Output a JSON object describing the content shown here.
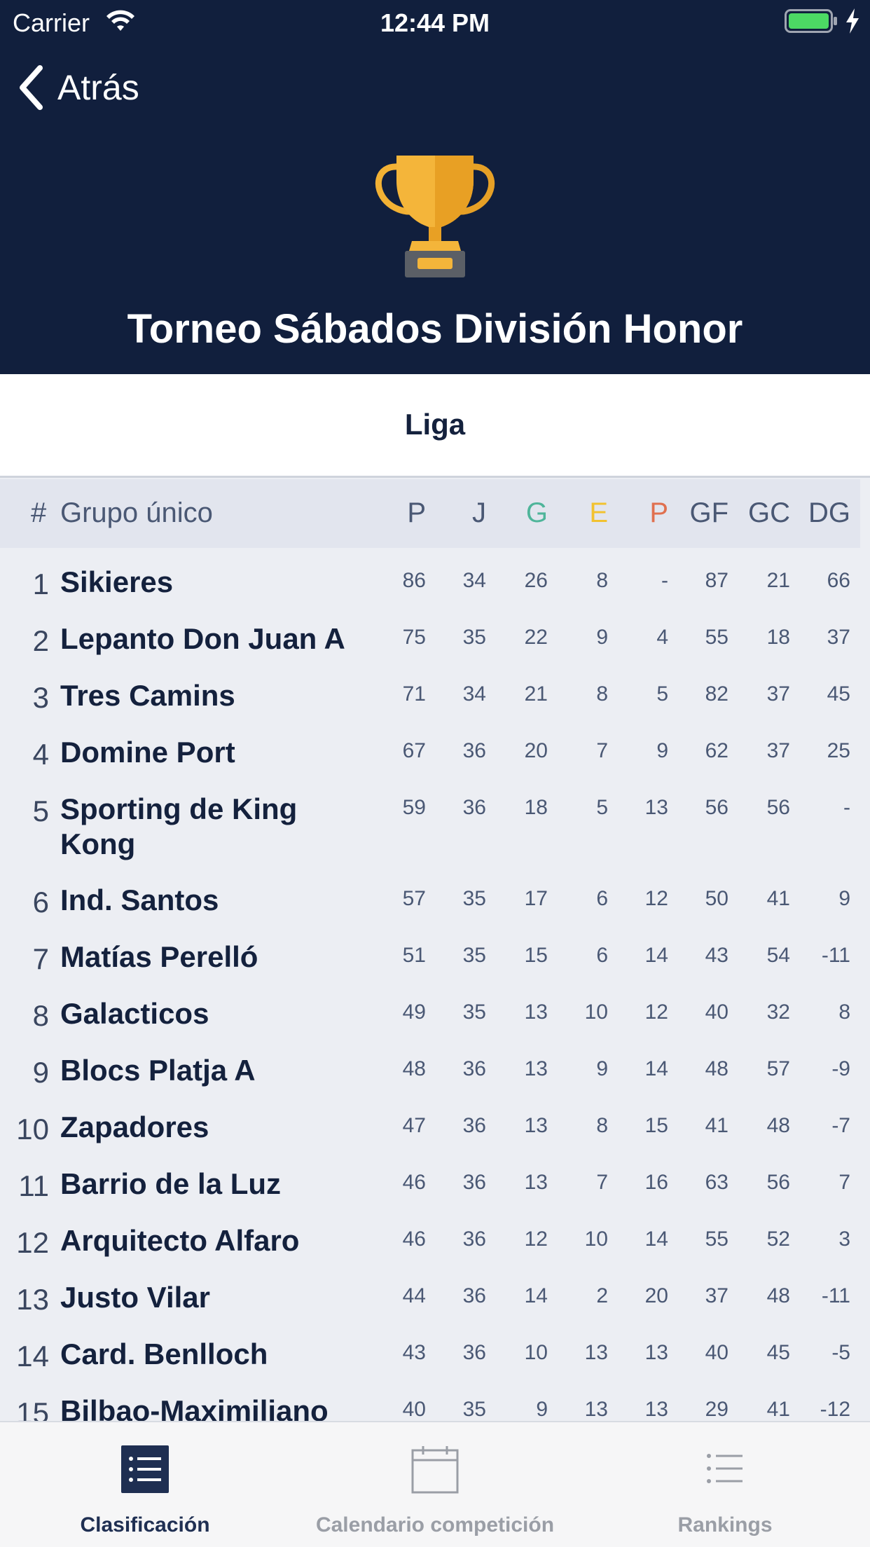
{
  "status_bar": {
    "carrier": "Carrier",
    "time": "12:44 PM"
  },
  "nav": {
    "back_label": "Atrás"
  },
  "header": {
    "title": "Torneo Sábados División Honor"
  },
  "segment": {
    "label": "Liga"
  },
  "table": {
    "headers": {
      "hash": "#",
      "group": "Grupo único",
      "pts": "P",
      "j": "J",
      "g": "G",
      "e": "E",
      "p": "P",
      "gf": "GF",
      "gc": "GC",
      "dg": "DG"
    },
    "header_colors": {
      "g": "#4fb59a",
      "e": "#f2c230",
      "p": "#e0704f"
    },
    "rows": [
      {
        "pos": "1",
        "team": "Sikieres",
        "pts": "86",
        "j": "34",
        "g": "26",
        "e": "8",
        "p": "-",
        "gf": "87",
        "gc": "21",
        "dg": "66"
      },
      {
        "pos": "2",
        "team": "Lepanto Don Juan A",
        "pts": "75",
        "j": "35",
        "g": "22",
        "e": "9",
        "p": "4",
        "gf": "55",
        "gc": "18",
        "dg": "37"
      },
      {
        "pos": "3",
        "team": "Tres Camins",
        "pts": "71",
        "j": "34",
        "g": "21",
        "e": "8",
        "p": "5",
        "gf": "82",
        "gc": "37",
        "dg": "45"
      },
      {
        "pos": "4",
        "team": "Domine Port",
        "pts": "67",
        "j": "36",
        "g": "20",
        "e": "7",
        "p": "9",
        "gf": "62",
        "gc": "37",
        "dg": "25"
      },
      {
        "pos": "5",
        "team": "Sporting de King Kong",
        "pts": "59",
        "j": "36",
        "g": "18",
        "e": "5",
        "p": "13",
        "gf": "56",
        "gc": "56",
        "dg": "-"
      },
      {
        "pos": "6",
        "team": "Ind. Santos",
        "pts": "57",
        "j": "35",
        "g": "17",
        "e": "6",
        "p": "12",
        "gf": "50",
        "gc": "41",
        "dg": "9"
      },
      {
        "pos": "7",
        "team": "Matías Perelló",
        "pts": "51",
        "j": "35",
        "g": "15",
        "e": "6",
        "p": "14",
        "gf": "43",
        "gc": "54",
        "dg": "-11"
      },
      {
        "pos": "8",
        "team": "Galacticos",
        "pts": "49",
        "j": "35",
        "g": "13",
        "e": "10",
        "p": "12",
        "gf": "40",
        "gc": "32",
        "dg": "8"
      },
      {
        "pos": "9",
        "team": "Blocs Platja A",
        "pts": "48",
        "j": "36",
        "g": "13",
        "e": "9",
        "p": "14",
        "gf": "48",
        "gc": "57",
        "dg": "-9"
      },
      {
        "pos": "10",
        "team": "Zapadores",
        "pts": "47",
        "j": "36",
        "g": "13",
        "e": "8",
        "p": "15",
        "gf": "41",
        "gc": "48",
        "dg": "-7"
      },
      {
        "pos": "11",
        "team": "Barrio de la Luz",
        "pts": "46",
        "j": "36",
        "g": "13",
        "e": "7",
        "p": "16",
        "gf": "63",
        "gc": "56",
        "dg": "7"
      },
      {
        "pos": "12",
        "team": "Arquitecto Alfaro",
        "pts": "46",
        "j": "36",
        "g": "12",
        "e": "10",
        "p": "14",
        "gf": "55",
        "gc": "52",
        "dg": "3"
      },
      {
        "pos": "13",
        "team": "Justo Vilar",
        "pts": "44",
        "j": "36",
        "g": "14",
        "e": "2",
        "p": "20",
        "gf": "37",
        "gc": "48",
        "dg": "-11"
      },
      {
        "pos": "14",
        "team": "Card. Benlloch",
        "pts": "43",
        "j": "36",
        "g": "10",
        "e": "13",
        "p": "13",
        "gf": "40",
        "gc": "45",
        "dg": "-5"
      },
      {
        "pos": "15",
        "team": "Bilbao-Maximiliano",
        "pts": "40",
        "j": "35",
        "g": "9",
        "e": "13",
        "p": "13",
        "gf": "29",
        "gc": "41",
        "dg": "-12"
      }
    ]
  },
  "tabbar": {
    "tabs": [
      {
        "label": "Clasificación",
        "icon": "list-icon",
        "active": true
      },
      {
        "label": "Calendario competición",
        "icon": "calendar-icon",
        "active": false
      },
      {
        "label": "Rankings",
        "icon": "list-icon",
        "active": false
      }
    ],
    "active_color": "#1f2f52",
    "inactive_color": "#9a9ea6"
  },
  "colors": {
    "header_bg": "#111f3d",
    "table_bg": "#eceef3",
    "battery": "#4cd964"
  }
}
